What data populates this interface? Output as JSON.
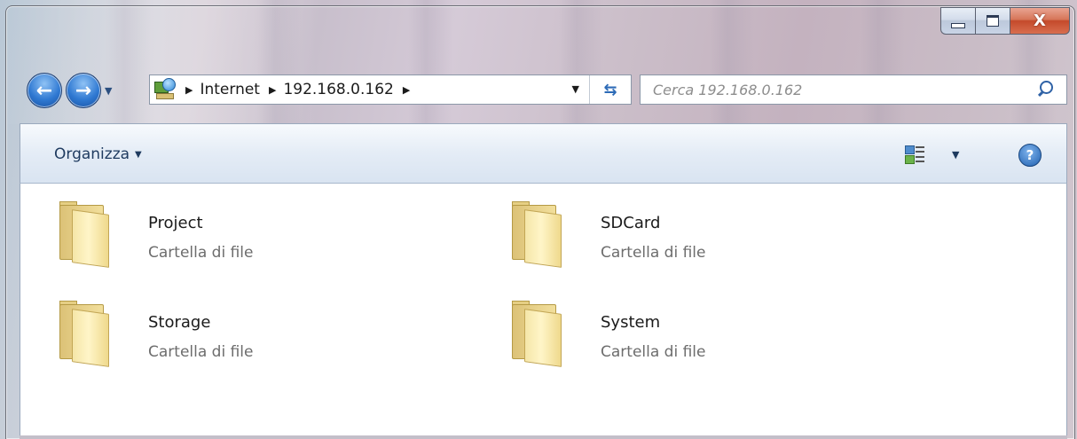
{
  "window": {
    "caption_buttons": {
      "minimize": "minimize",
      "maximize": "maximize",
      "close": "X"
    }
  },
  "navigation": {
    "back": "back-arrow",
    "forward": "forward-arrow"
  },
  "address_bar": {
    "icon": "network-icon",
    "breadcrumbs": [
      "Internet",
      "192.168.0.162"
    ]
  },
  "search": {
    "placeholder": "Cerca 192.168.0.162"
  },
  "toolbar": {
    "organize_label": "Organizza"
  },
  "items": [
    {
      "name": "Project",
      "type": "Cartella di file"
    },
    {
      "name": "SDCard",
      "type": "Cartella di file"
    },
    {
      "name": "Storage",
      "type": "Cartella di file"
    },
    {
      "name": "System",
      "type": "Cartella di file"
    }
  ]
}
